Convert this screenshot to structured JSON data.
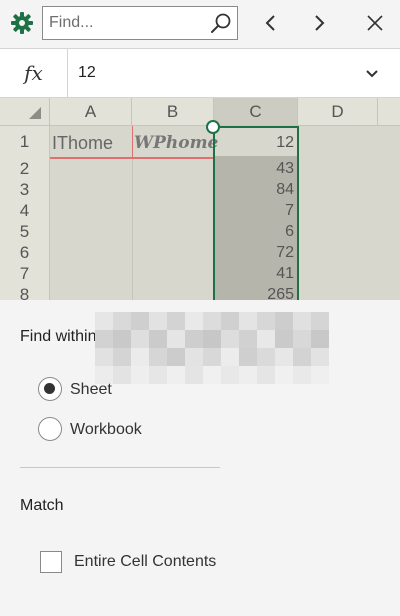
{
  "toolbar": {
    "search": {
      "placeholder": "Find...",
      "value": ""
    },
    "icons": {
      "settings": "gear-icon",
      "search": "search-icon",
      "previous": "chevron-left-icon",
      "next": "chevron-right-icon",
      "close": "close-icon"
    },
    "accent_color": "#1e7145"
  },
  "formula_bar": {
    "fx_label": "fx",
    "value": "12",
    "expand_icon": "chevron-down-icon"
  },
  "sheet": {
    "columns": [
      "A",
      "B",
      "C",
      "D"
    ],
    "rows": [
      "1",
      "2",
      "3",
      "4",
      "5",
      "6",
      "7",
      "8"
    ],
    "cells": {
      "A1": "IThome",
      "B1": "WPhome",
      "C1": "12",
      "C2": "43",
      "C3": "84",
      "C4": "7",
      "C5": "6",
      "C6": "72",
      "C7": "41",
      "C8": "265"
    },
    "selected_column": "C"
  },
  "find_within": {
    "title": "Find within",
    "options": [
      {
        "label": "Sheet",
        "checked": true
      },
      {
        "label": "Workbook",
        "checked": false
      }
    ]
  },
  "match": {
    "title": "Match",
    "entire_cell_contents": {
      "label": "Entire Cell Contents",
      "checked": false
    }
  }
}
